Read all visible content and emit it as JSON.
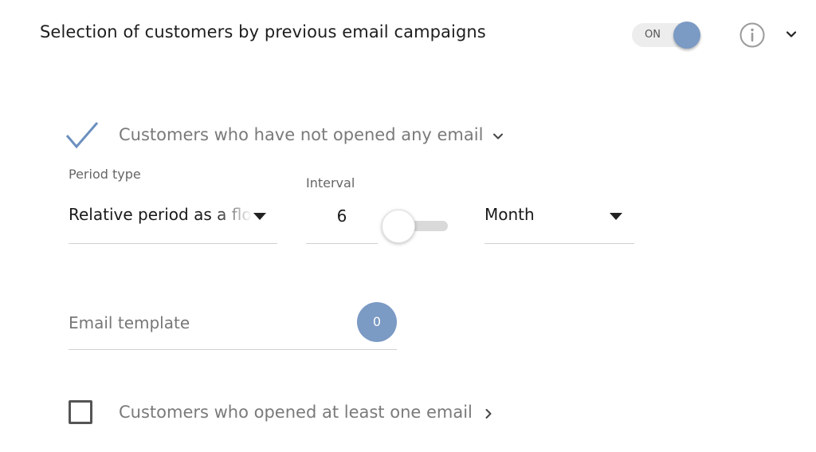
{
  "header": {
    "title": "Selection of customers by previous email campaigns",
    "toggle": {
      "label": "ON",
      "state": "on",
      "color": "#7b9ac4"
    },
    "info_icon": "info-circle-icon",
    "chevron_icon": "chevron-down-icon"
  },
  "option_not_opened": {
    "label": "Customers who have not opened any email",
    "checked": true,
    "check_color": "#6b8fbf",
    "expand_icon": "chevron-down-icon"
  },
  "period_type": {
    "caption": "Period type",
    "value": "Relative period as a floating"
  },
  "interval": {
    "caption": "Interval",
    "value": "6",
    "switch_state": "off"
  },
  "period_unit": {
    "value": "Month"
  },
  "email_template": {
    "placeholder": "Email template",
    "count": "0",
    "badge_color": "#7b9ac4"
  },
  "option_opened": {
    "label": "Customers who opened at least one email",
    "checked": false,
    "expand_icon": "chevron-right-icon"
  }
}
